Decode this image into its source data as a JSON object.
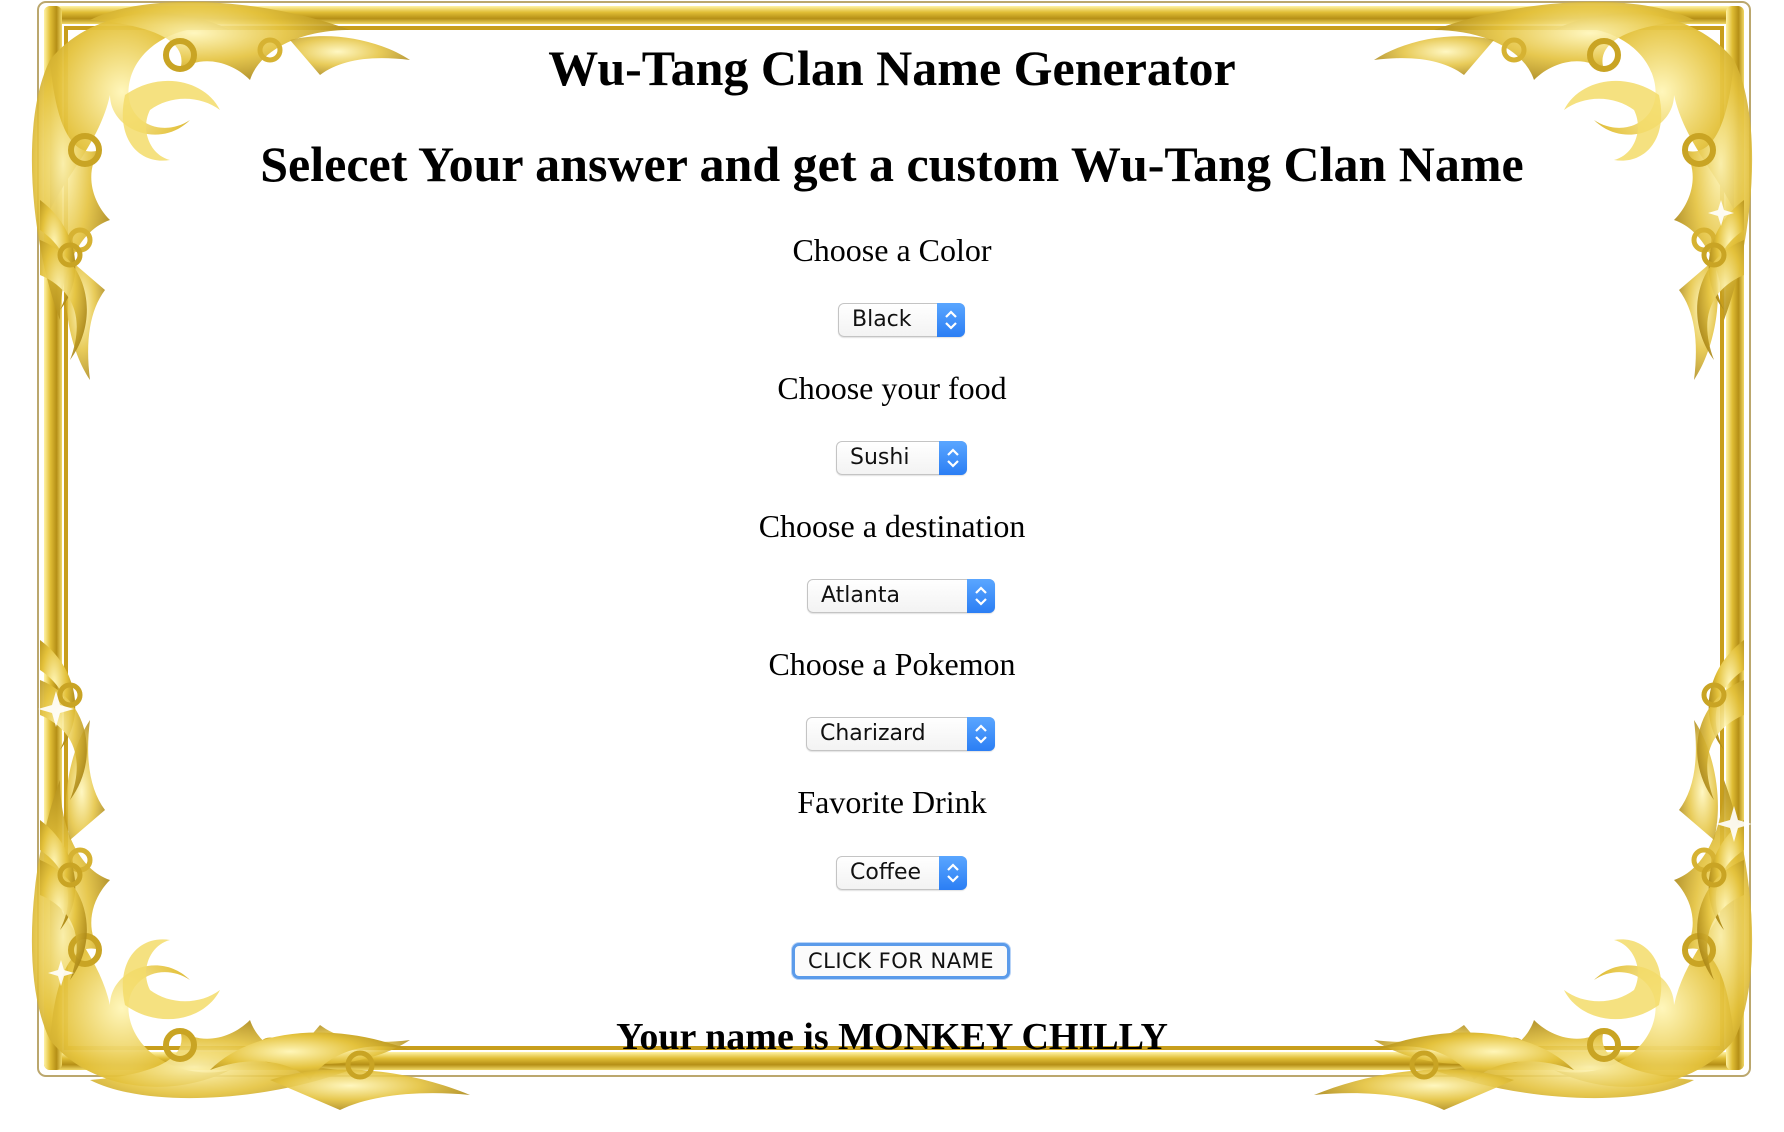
{
  "header": {
    "title": "Wu-Tang Clan Name Generator",
    "subtitle": "Selecet Your answer and get a custom Wu-Tang Clan Name"
  },
  "questions": [
    {
      "label": "Choose a Color",
      "selected": "Black"
    },
    {
      "label": "Choose your food",
      "selected": "Sushi"
    },
    {
      "label": "Choose a destination",
      "selected": "Atlanta"
    },
    {
      "label": "Choose a Pokemon",
      "selected": "Charizard"
    },
    {
      "label": "Favorite Drink",
      "selected": "Coffee"
    }
  ],
  "button": {
    "label": "CLICK FOR NAME"
  },
  "result": {
    "text": "Your name is MONKEY CHILLY"
  },
  "colors": {
    "frame_gold": "#d8b42a",
    "frame_light": "#f5e27a",
    "frame_dark": "#9b7a10",
    "select_arrow_blue": "#2f80f5",
    "button_focus_ring": "#5b9bea"
  },
  "icons": {
    "select_arrow": "chevron-up-down-icon",
    "frame_ornament": "gold-scroll-ornament"
  }
}
